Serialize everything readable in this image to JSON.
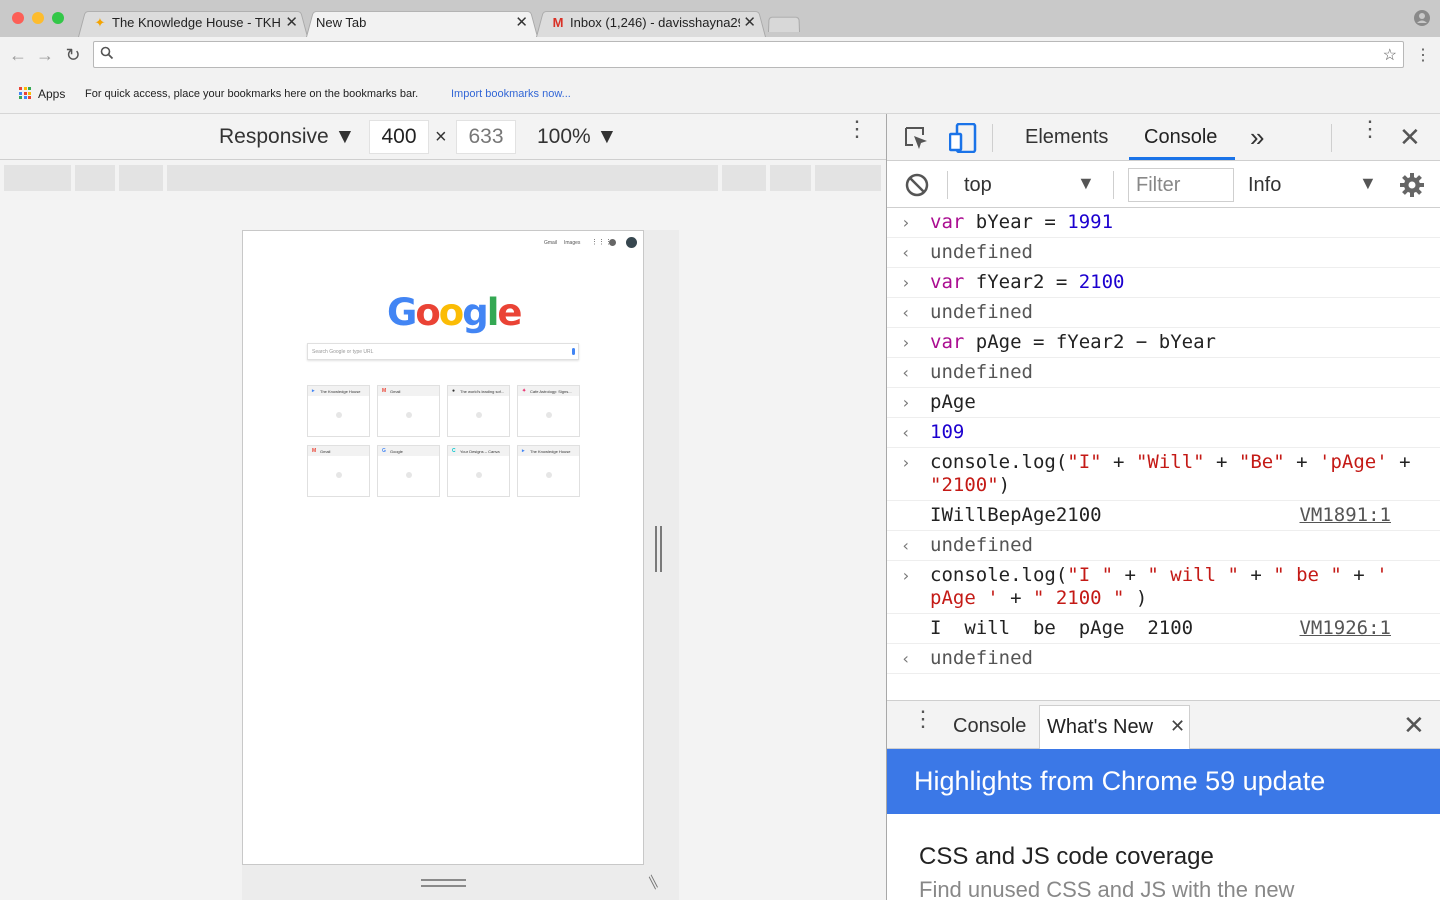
{
  "window": {
    "traffic_colors": [
      "#fc5f57",
      "#fdbc2e",
      "#33c748"
    ]
  },
  "tabs": [
    {
      "title": "The Knowledge House - TKH - ...",
      "icon": "tkh-logo-icon",
      "close": "✕"
    },
    {
      "title": "New Tab",
      "close": "✕",
      "active": true
    },
    {
      "title": "Inbox (1,246) - davisshayna29...",
      "icon": "gmail-icon",
      "close": "✕"
    }
  ],
  "toolbar": {
    "back": "←",
    "forward": "→",
    "reload": "↻",
    "omnibox_value": "",
    "star": "☆",
    "menu": "⋮"
  },
  "bookmarks": {
    "apps_label": "Apps",
    "hint": "For quick access, place your bookmarks here on the bookmarks bar.",
    "import_link": "Import bookmarks now...",
    "apps_colors": [
      "#ea4335",
      "#fbbc05",
      "#34a853",
      "#4285f4",
      "#ea4335",
      "#fbbc05",
      "#34a853",
      "#4285f4",
      "#ea4335"
    ]
  },
  "emulation": {
    "mode": "Responsive ▼",
    "width": "400",
    "times": "×",
    "height": "633",
    "zoom": "100% ▼",
    "more": "⋮"
  },
  "device_page": {
    "gmail": "Gmail",
    "images": "Images",
    "logo": [
      "G",
      "o",
      "o",
      "g",
      "l",
      "e"
    ],
    "logo_colors": [
      "#4285f4",
      "#ea4335",
      "#fbbc05",
      "#4285f4",
      "#34a853",
      "#ea4335"
    ],
    "search_placeholder": "Search Google or type URL",
    "thumbnails": [
      {
        "title": "The Knowledge House",
        "fav": "▸",
        "fav_color": "#4285f4"
      },
      {
        "title": "Gmail",
        "fav": "M",
        "fav_color": "#ea4335"
      },
      {
        "title": "The world's leading sof...",
        "fav": "●",
        "fav_color": "#333333"
      },
      {
        "title": "Cafe Astrology: Signs...",
        "fav": "✦",
        "fav_color": "#e91e63"
      },
      {
        "title": "Gmail",
        "fav": "M",
        "fav_color": "#ea4335"
      },
      {
        "title": "Google",
        "fav": "G",
        "fav_color": "#4285f4"
      },
      {
        "title": "Your Designs – Canva",
        "fav": "C",
        "fav_color": "#00c4cc"
      },
      {
        "title": "The Knowledge House",
        "fav": "▸",
        "fav_color": "#4285f4"
      }
    ]
  },
  "devtools": {
    "tabs": {
      "elements": "Elements",
      "console": "Console",
      "more": "»"
    },
    "menu": "⋮",
    "close": "✕",
    "context": "top",
    "filter_placeholder": "Filter",
    "level": "Info",
    "dropdown_arrow": "▼",
    "log": [
      {
        "kind": "input",
        "tokens": [
          {
            "c": "kw",
            "t": "var"
          },
          {
            "c": "",
            "t": " bYear = "
          },
          {
            "c": "num",
            "t": "1991"
          }
        ]
      },
      {
        "kind": "result",
        "text": "undefined"
      },
      {
        "kind": "input",
        "tokens": [
          {
            "c": "kw",
            "t": "var"
          },
          {
            "c": "",
            "t": " fYear2 = "
          },
          {
            "c": "num",
            "t": "2100"
          }
        ]
      },
      {
        "kind": "result",
        "text": "undefined"
      },
      {
        "kind": "input",
        "tokens": [
          {
            "c": "kw",
            "t": "var"
          },
          {
            "c": "",
            "t": " pAge = fYear2 − bYear"
          }
        ]
      },
      {
        "kind": "result",
        "text": "undefined"
      },
      {
        "kind": "input",
        "tokens": [
          {
            "c": "",
            "t": "pAge"
          }
        ]
      },
      {
        "kind": "result-num",
        "text": "109"
      },
      {
        "kind": "input",
        "tokens": [
          {
            "c": "",
            "t": "console.log("
          },
          {
            "c": "str",
            "t": "\"I\""
          },
          {
            "c": "",
            "t": " + "
          },
          {
            "c": "str",
            "t": "\"Will\""
          },
          {
            "c": "",
            "t": " + "
          },
          {
            "c": "str",
            "t": "\"Be\""
          },
          {
            "c": "",
            "t": " + "
          },
          {
            "c": "str",
            "t": "'pAge'"
          },
          {
            "c": "",
            "t": " + "
          },
          {
            "c": "str",
            "t": "\"2100\""
          },
          {
            "c": "",
            "t": ")"
          }
        ]
      },
      {
        "kind": "output",
        "text": "IWillBepAge2100",
        "source": "VM1891:1"
      },
      {
        "kind": "result",
        "text": "undefined"
      },
      {
        "kind": "input",
        "tokens": [
          {
            "c": "",
            "t": "console.log("
          },
          {
            "c": "str",
            "t": "\"I \""
          },
          {
            "c": "",
            "t": " + "
          },
          {
            "c": "str",
            "t": "\" will \""
          },
          {
            "c": "",
            "t": " + "
          },
          {
            "c": "str",
            "t": "\" be \""
          },
          {
            "c": "",
            "t": " + "
          },
          {
            "c": "str",
            "t": "' pAge '"
          },
          {
            "c": "",
            "t": " + "
          },
          {
            "c": "str",
            "t": "\" 2100 \""
          },
          {
            "c": "",
            "t": " )"
          }
        ]
      },
      {
        "kind": "output",
        "text": "I  will  be  pAge  2100",
        "source": "VM1926:1"
      },
      {
        "kind": "result",
        "text": "undefined"
      }
    ],
    "drawer": {
      "menu": "⋮",
      "console_tab": "Console",
      "whats_new_tab": "What's New",
      "tab_close": "✕",
      "close": "✕",
      "banner": "Highlights from Chrome 59 update",
      "item_title": "CSS and JS code coverage",
      "item_desc": "Find unused CSS and JS with the new"
    }
  }
}
